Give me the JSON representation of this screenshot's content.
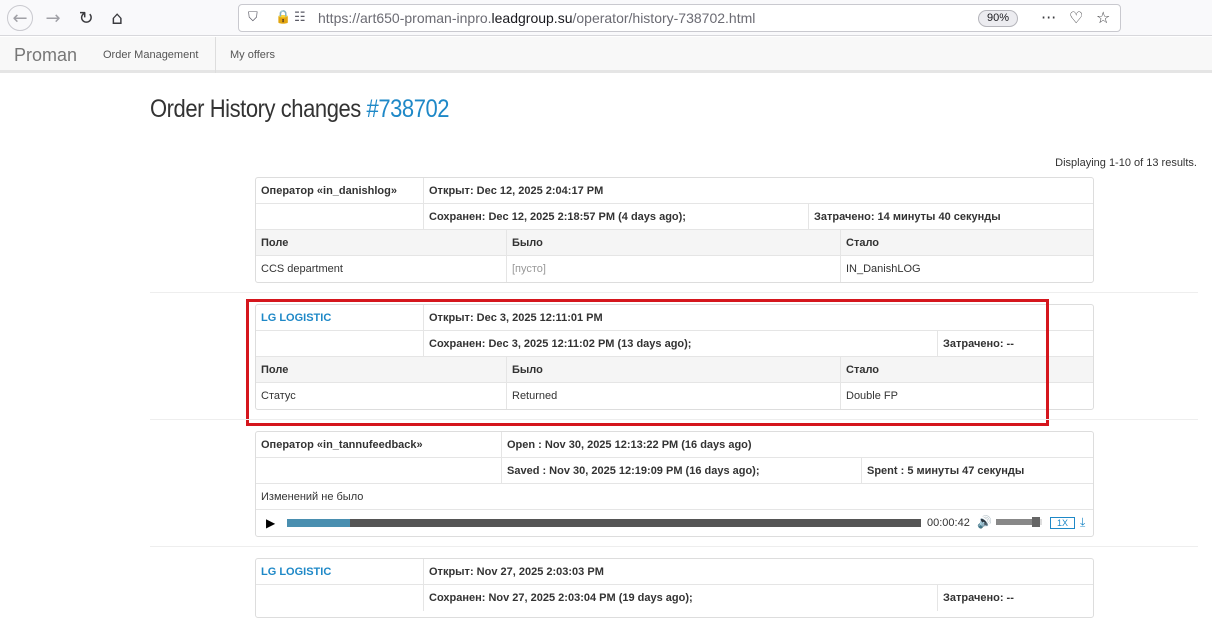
{
  "browser": {
    "url_prefix": "https://art650-proman-inpro.",
    "url_domain": "leadgroup.su",
    "url_path": "/operator/history-738702.html",
    "zoom": "90%"
  },
  "app": {
    "brand": "Proman",
    "menu": [
      "Order Management",
      "My offers"
    ]
  },
  "page": {
    "title_text": "Order History changes ",
    "title_link": "#738702",
    "summary": "Displaying 1-10 of 13 results."
  },
  "records": [
    {
      "operator": "Оператор «in_danishlog»",
      "opened": "Открыт: Dec 12, 2025 2:04:17 PM",
      "saved": "Сохранен: Dec 12, 2025 2:18:57 PM (4 days ago);",
      "spent": "Затрачено: 14 минуты 40 секунды",
      "headers": [
        "Поле",
        "Было",
        "Стало"
      ],
      "change": {
        "field": "CCS department",
        "was": "[пусто]",
        "became": "IN_DanishLOG"
      }
    },
    {
      "operator": "LG LOGISTIC",
      "opened": "Открыт: Dec 3, 2025 12:11:01 PM",
      "saved": "Сохранен: Dec 3, 2025 12:11:02 PM (13 days ago);",
      "spent": "Затрачено: --",
      "headers": [
        "Поле",
        "Было",
        "Стало"
      ],
      "change": {
        "field": "Статус",
        "was": "Returned",
        "became": "Double FP"
      }
    },
    {
      "operator": "Оператор «in_tannufeedback»",
      "opened": "Open : Nov 30, 2025 12:13:22 PM (16 days ago)",
      "saved": "Saved : Nov 30, 2025 12:19:09 PM (16 days ago);",
      "spent": "Spent : 5 минуты 47 секунды",
      "note": "Изменений не было",
      "player": {
        "time": "00:00:42",
        "progress": 0.1,
        "volume": 0.8,
        "speed": "1X"
      }
    },
    {
      "operator": "LG LOGISTIC",
      "opened": "Открыт: Nov 27, 2025 2:03:03 PM",
      "saved": "Сохранен: Nov 27, 2025 2:03:04 PM (19 days ago);",
      "spent": "Затрачено: --"
    }
  ]
}
